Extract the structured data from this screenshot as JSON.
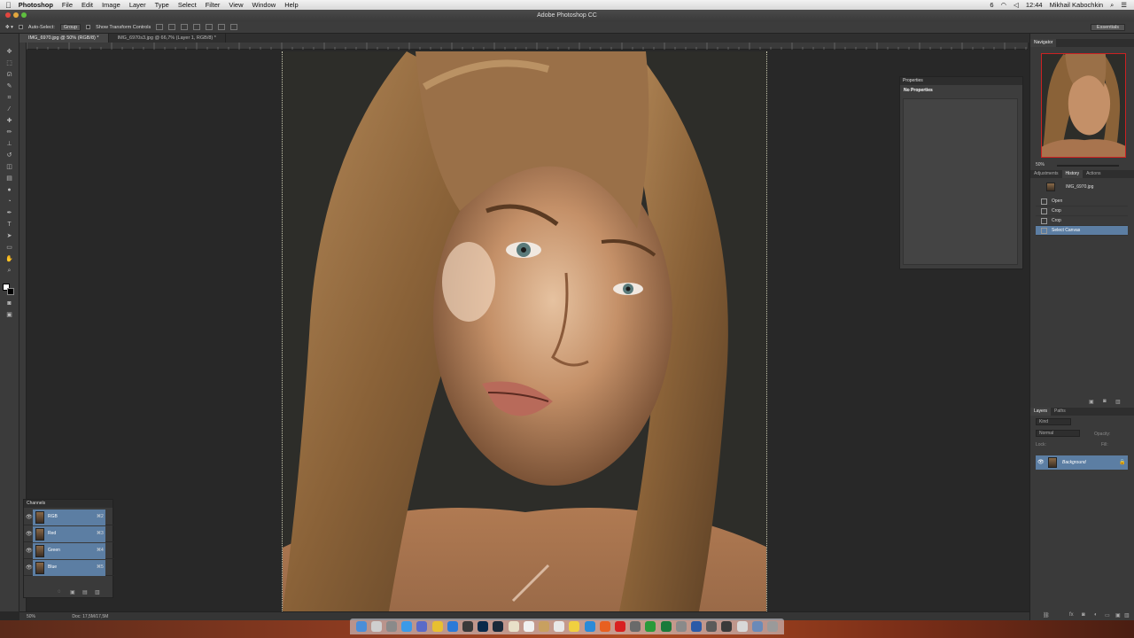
{
  "menubar": {
    "app": "Photoshop",
    "items": [
      "File",
      "Edit",
      "Image",
      "Layer",
      "Type",
      "Select",
      "Filter",
      "View",
      "Window",
      "Help"
    ],
    "right": {
      "indicator": "6",
      "clock": "12:44",
      "user": "Mikhail Kabochkin"
    }
  },
  "window": {
    "title": "Adobe Photoshop CC"
  },
  "options": {
    "auto_select": "Auto-Select:",
    "group": "Group",
    "show_transform": "Show Transform Controls",
    "workspace": "Essentials"
  },
  "tabs": [
    {
      "label": "IMG_6970.jpg @ 50% (RGB/8) *",
      "active": true
    },
    {
      "label": "IMG_6970s3.jpg @ 66,7% (Layer 1, RGB/8) *",
      "active": false
    }
  ],
  "channels": {
    "title": "Channels",
    "rows": [
      {
        "name": "RGB",
        "shortcut": "⌘2"
      },
      {
        "name": "Red",
        "shortcut": "⌘3"
      },
      {
        "name": "Green",
        "shortcut": "⌘4"
      },
      {
        "name": "Blue",
        "shortcut": "⌘5"
      }
    ]
  },
  "properties": {
    "title": "Properties",
    "body": "No Properties"
  },
  "navigator": {
    "title": "Navigator",
    "zoom": "50%"
  },
  "history": {
    "tabs": [
      "Adjustments",
      "History",
      "Actions"
    ],
    "snapshot": "IMG_6970.jpg",
    "rows": [
      "Open",
      "Crop",
      "Crop",
      "Select Canvas"
    ]
  },
  "layers": {
    "tabs": [
      "Layers",
      "Paths"
    ],
    "kind": "Kind",
    "blend": "Normal",
    "opacity_label": "Opacity:",
    "lock_label": "Lock:",
    "fill_label": "Fill:",
    "layer_name": "Background"
  },
  "status": {
    "zoom": "50%",
    "doc": "Doc: 17,5M/17,5M"
  },
  "colors": {
    "selection": "#5c7ea3",
    "accent_red": "#cc2222"
  }
}
